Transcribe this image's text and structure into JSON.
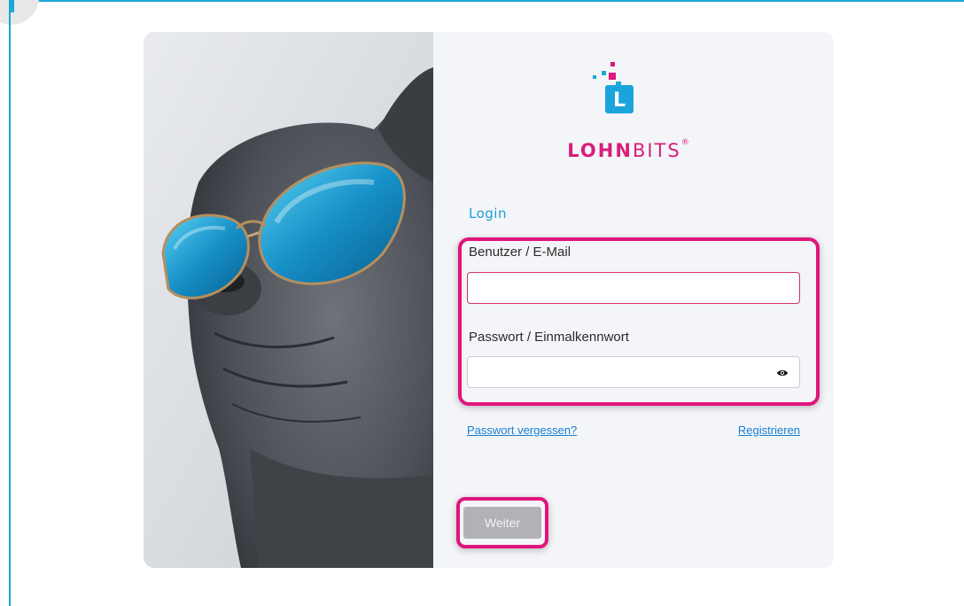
{
  "brand": {
    "name_bold": "LOHN",
    "name_light": "BITS",
    "trademark": "®",
    "icon_letter": "L",
    "colors": {
      "magenta": "#e0157d",
      "cyan": "#19a8d8"
    }
  },
  "login": {
    "title": "Login",
    "user_label": "Benutzer / E-Mail",
    "user_value": "",
    "password_label": "Passwort / Einmalkennwort",
    "password_value": "",
    "password_toggle_icon": "eye-icon",
    "forgot_link": "Passwort vergessen?",
    "register_link": "Registrieren",
    "submit_label": "Weiter"
  },
  "hero": {
    "image": "dog-with-sunglasses"
  }
}
